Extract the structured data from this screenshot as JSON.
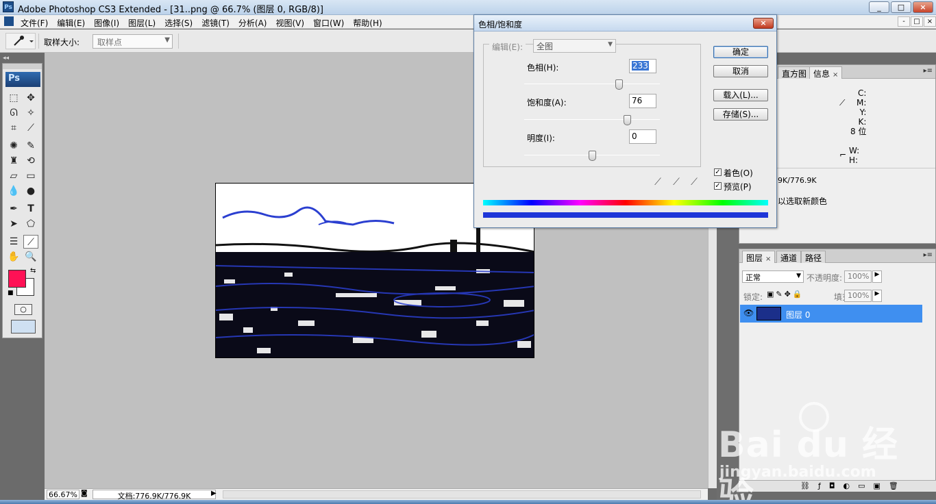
{
  "window": {
    "title": "Adobe Photoshop CS3 Extended - [31..png @ 66.7% (图层 0, RGB/8)]",
    "app_icon": "Ps",
    "controls": [
      "_",
      "□",
      "×"
    ]
  },
  "menubar": {
    "items": [
      "文件(F)",
      "编辑(E)",
      "图像(I)",
      "图层(L)",
      "选择(S)",
      "滤镜(T)",
      "分析(A)",
      "视图(V)",
      "窗口(W)",
      "帮助(H)"
    ],
    "doc_controls": [
      "-",
      "□",
      "×"
    ]
  },
  "options_bar": {
    "sample_size_label": "取样大小:",
    "sample_size_value": "取样点"
  },
  "toolbox": {
    "logo": "Ps",
    "foreground_color": "#ff1155",
    "background_color": "#ffffff"
  },
  "status": {
    "zoom": "66.67%",
    "doc_size": "文档:776.9K/776.9K"
  },
  "dialog": {
    "title": "色相/饱和度",
    "close": "×",
    "edit_label": "编辑(E):",
    "edit_value": "全图",
    "hue_label": "色相(H):",
    "hue_value": "233",
    "saturation_label": "饱和度(A):",
    "saturation_value": "76",
    "lightness_label": "明度(I):",
    "lightness_value": "0",
    "hue_fraction": 0.7,
    "saturation_fraction": 0.76,
    "lightness_fraction": 0.5,
    "ok_label": "确定",
    "cancel_label": "取消",
    "load_label": "载入(L)...",
    "save_label": "存储(S)...",
    "colorize_label": "着色(O)",
    "colorize_checked": true,
    "preview_label": "预览(P)",
    "preview_checked": true
  },
  "info_panel": {
    "tabs": [
      "直方图",
      "信息"
    ],
    "cmyk_labels": [
      "C:",
      "M:",
      "Y:",
      "K:"
    ],
    "bit_depth": "8 位",
    "wh_labels": [
      "W:",
      "H:"
    ],
    "doc_size": "9K/776.9K",
    "hint": "以选取新颜色"
  },
  "layers_panel": {
    "tabs": [
      "图层",
      "通道",
      "路径"
    ],
    "blend_mode": "正常",
    "opacity_label": "不透明度:",
    "opacity_value": "100%",
    "lock_label": "锁定:",
    "fill_label": "填充:",
    "fill_value": "100%",
    "layer_name": "图层 0"
  },
  "watermark": {
    "brand": "Bai du 经验",
    "url": "jingyan.baidu.com"
  },
  "colors": {
    "accent_selection": "#3f8ff0",
    "colorized_blue": "#1f36d8"
  }
}
